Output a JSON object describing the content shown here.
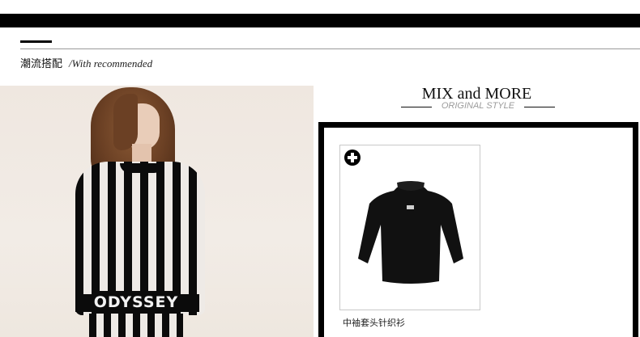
{
  "section": {
    "title_cn": "潮流搭配",
    "title_en": "/With recommended"
  },
  "model_photo": {
    "sweater_text": "ODYSSEY"
  },
  "mix": {
    "title": "MIX and MORE",
    "subtitle": "ORIGINAL STYLE"
  },
  "products": [
    {
      "name": "中袖套头针织衫",
      "image_icon": "black-knit-top",
      "add_icon": "plus-circle-icon"
    }
  ]
}
